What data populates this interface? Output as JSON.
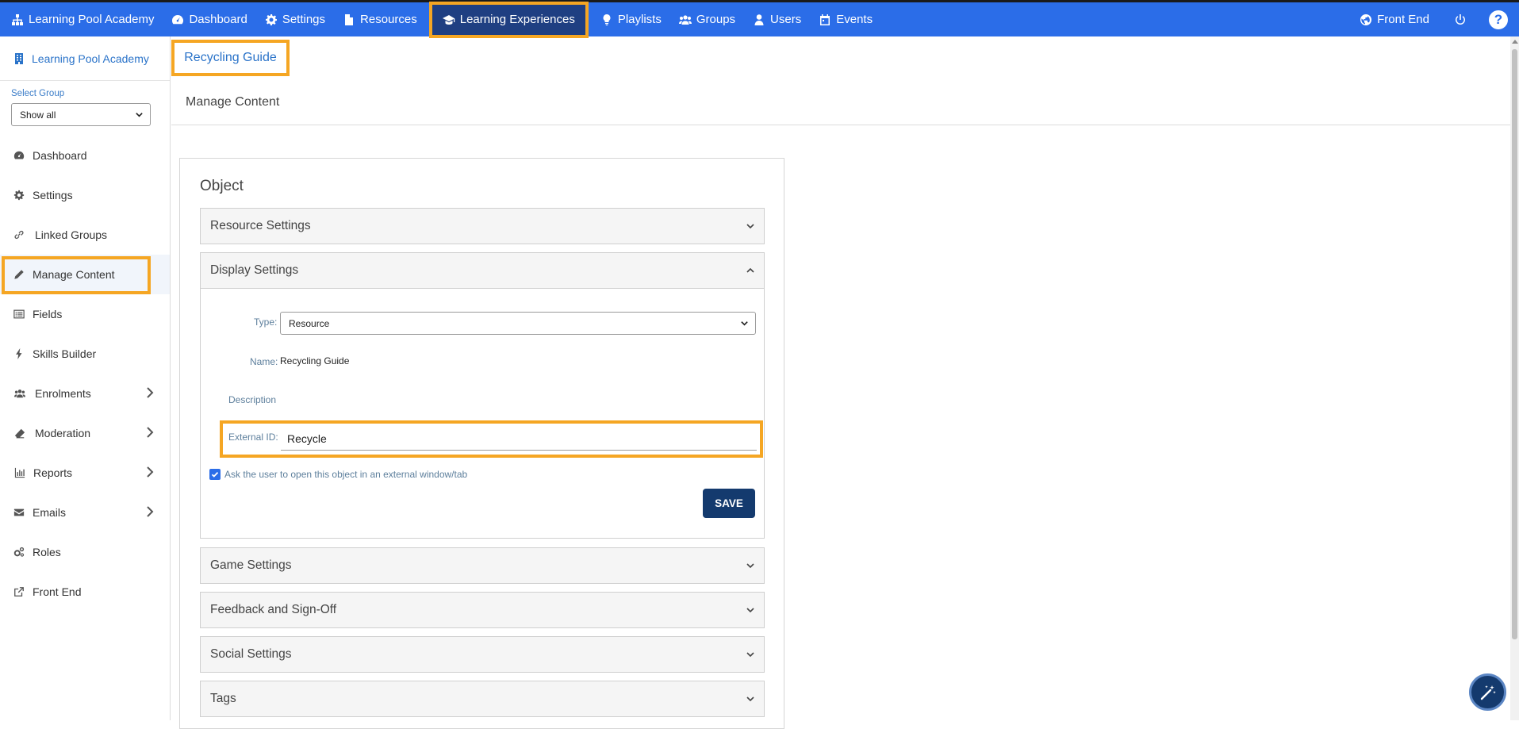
{
  "topnav": {
    "items": [
      {
        "label": "Learning Pool Academy",
        "icon": "sitemap-icon"
      },
      {
        "label": "Dashboard",
        "icon": "gauge-icon"
      },
      {
        "label": "Settings",
        "icon": "gear-icon"
      },
      {
        "label": "Resources",
        "icon": "file-icon"
      },
      {
        "label": "Learning Experiences",
        "icon": "graduation-cap-icon"
      },
      {
        "label": "Playlists",
        "icon": "lightbulb-icon"
      },
      {
        "label": "Groups",
        "icon": "users-icon"
      },
      {
        "label": "Users",
        "icon": "user-icon"
      },
      {
        "label": "Events",
        "icon": "calendar-icon"
      }
    ],
    "front_end": "Front End",
    "help": "?",
    "active_color": "#1f3f82",
    "bar_color": "#2b6de8",
    "highlight_color": "#f5a623"
  },
  "sidebar": {
    "brand": "Learning Pool Academy",
    "select_group_label": "Select Group",
    "select_group_value": "Show all",
    "items": [
      {
        "label": "Dashboard",
        "icon": "gauge-icon"
      },
      {
        "label": "Settings",
        "icon": "gear-icon"
      },
      {
        "label": "Linked Groups",
        "icon": "link-icon"
      },
      {
        "label": "Manage Content",
        "icon": "pencil-icon"
      },
      {
        "label": "Fields",
        "icon": "list-icon"
      },
      {
        "label": "Skills Builder",
        "icon": "bolt-icon"
      },
      {
        "label": "Enrolments",
        "icon": "users-icon"
      },
      {
        "label": "Moderation",
        "icon": "eraser-icon"
      },
      {
        "label": "Reports",
        "icon": "bar-chart-icon"
      },
      {
        "label": "Emails",
        "icon": "envelope-icon"
      },
      {
        "label": "Roles",
        "icon": "gears-icon"
      },
      {
        "label": "Front End",
        "icon": "external-link-icon"
      }
    ]
  },
  "main": {
    "page_title": "Recycling Guide",
    "subtitle": "Manage Content",
    "panel_title": "Object",
    "sections": {
      "resource_settings": "Resource Settings",
      "display_settings": "Display Settings",
      "game_settings": "Game Settings",
      "feedback": "Feedback and Sign-Off",
      "social": "Social Settings",
      "tags": "Tags"
    },
    "display": {
      "type_label": "Type:",
      "type_value": "Resource",
      "name_label": "Name:",
      "name_value": "Recycling Guide",
      "description_label": "Description",
      "external_id_label": "External ID:",
      "external_id_value": "Recycle",
      "checkbox_label": "Ask the user to open this object in an external window/tab",
      "checkbox_checked": true,
      "save_label": "SAVE"
    }
  }
}
